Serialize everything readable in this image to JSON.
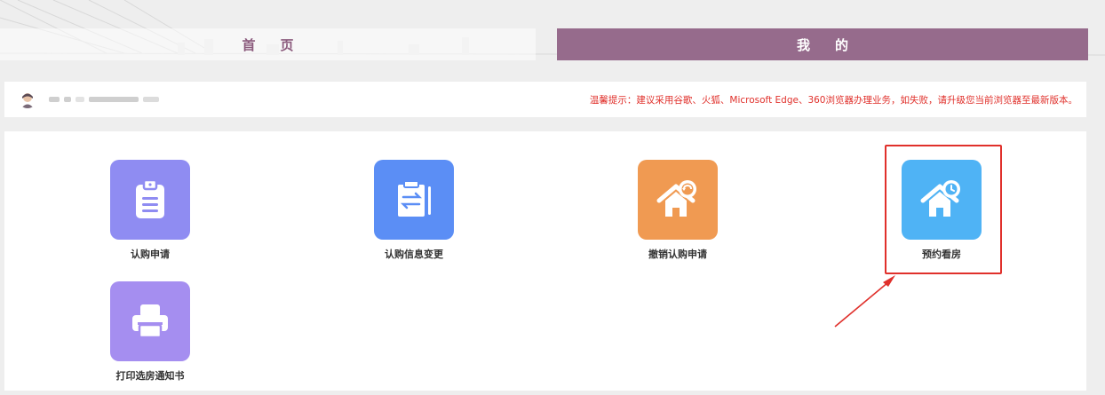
{
  "nav": {
    "home_label": "首页",
    "mine_label": "我的"
  },
  "userbar": {
    "tip": "温馨提示：建议采用谷歌、火狐、Microsoft Edge、360浏览器办理业务，如失败，请升级您当前浏览器至最新版本。"
  },
  "tiles": [
    {
      "label": "认购申请",
      "icon": "clipboard-icon",
      "color": "#8f8cf2"
    },
    {
      "label": "认购信息变更",
      "icon": "swap-document-icon",
      "color": "#5b8ef5"
    },
    {
      "label": "撤销认购申请",
      "icon": "house-undo-icon",
      "color": "#f09a52"
    },
    {
      "label": "预约看房",
      "icon": "house-clock-icon",
      "color": "#4fb3f5"
    },
    {
      "label": "打印选房通知书",
      "icon": "printer-icon",
      "color": "#a58ef0"
    }
  ],
  "colors": {
    "accent": "#966b8c",
    "tip": "#e0302b",
    "highlight": "#e0302b"
  }
}
